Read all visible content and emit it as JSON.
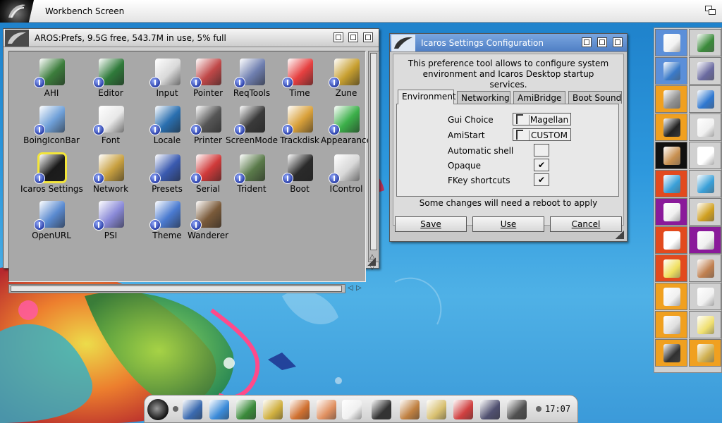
{
  "screen": {
    "title": "Workbench Screen"
  },
  "prefs_window": {
    "title": "AROS:Prefs,  9.5G free, 543.7M in use, 5% full",
    "icons": [
      {
        "label": "AHI",
        "icon": "audio-hardware-icon",
        "color": "#3c7d3c"
      },
      {
        "label": "Editor",
        "icon": "editor-icon",
        "color": "#2f7a3a"
      },
      {
        "label": "Input",
        "icon": "mouse-icon",
        "color": "#d9d9d9"
      },
      {
        "label": "Pointer",
        "icon": "pointer-icon",
        "color": "#c04848"
      },
      {
        "label": "ReqTools",
        "icon": "reqtools-icon",
        "color": "#6f7fb0"
      },
      {
        "label": "Time",
        "icon": "clock-icon",
        "color": "#e64040"
      },
      {
        "label": "Zune",
        "icon": "zune-icon",
        "color": "#c8a030"
      },
      {
        "label": "BoingIconBar",
        "icon": "boing-icon-bar-icon",
        "color": "#6fa0d8"
      },
      {
        "label": "Font",
        "icon": "font-icon",
        "color": "#e8e8e8"
      },
      {
        "label": "Locale",
        "icon": "globe-map-icon",
        "color": "#2a6fb0"
      },
      {
        "label": "Printer",
        "icon": "printer-icon",
        "color": "#555555"
      },
      {
        "label": "ScreenMode",
        "icon": "monitor-icon",
        "color": "#3a3a3a"
      },
      {
        "label": "Trackdisk",
        "icon": "floppy-disk-icon",
        "color": "#d9a13a"
      },
      {
        "label": "Appearance",
        "icon": "appearance-icon",
        "color": "#3cb04a"
      },
      {
        "label": "Icaros Settings",
        "icon": "icaros-logo-icon",
        "color": "#1a1a1a"
      },
      {
        "label": "Network",
        "icon": "network-globe-icon",
        "color": "#c8a040"
      },
      {
        "label": "Presets",
        "icon": "presets-icon",
        "color": "#3a5ab0"
      },
      {
        "label": "Serial",
        "icon": "serial-plug-icon",
        "color": "#d03a3a"
      },
      {
        "label": "Trident",
        "icon": "trident-icon",
        "color": "#5a7a4a"
      },
      {
        "label": "Boot",
        "icon": "boot-terminal-icon",
        "color": "#2a2a2a"
      },
      {
        "label": "IControl",
        "icon": "icontrol-icon",
        "color": "#d8d8d8"
      },
      {
        "label": "OpenURL",
        "icon": "open-url-icon",
        "color": "#5a8ad0"
      },
      {
        "label": "PSI",
        "icon": "psi-screen-icon",
        "color": "#8a8ad8"
      },
      {
        "label": "Theme",
        "icon": "theme-icon",
        "color": "#4a7ad0"
      },
      {
        "label": "Wanderer",
        "icon": "wanderer-icon",
        "color": "#7a5a3a"
      }
    ]
  },
  "icaros_window": {
    "title": "Icaros Settings Configuration",
    "description": "This preference tool allows to configure system environment and Icaros Desktop startup services.",
    "tabs": [
      {
        "label": "Environment",
        "active": true
      },
      {
        "label": "Networking",
        "active": false
      },
      {
        "label": "AmiBridge",
        "active": false
      },
      {
        "label": "Boot Sound",
        "active": false
      }
    ],
    "rows": [
      {
        "label": "Gui Choice",
        "type": "cycle",
        "value": "Magellan"
      },
      {
        "label": "AmiStart",
        "type": "cycle",
        "value": "CUSTOM"
      },
      {
        "label": "Automatic shell",
        "type": "checkbox",
        "value": ""
      },
      {
        "label": "Opaque",
        "type": "checkbox",
        "value": "✔"
      },
      {
        "label": "FKey shortcuts",
        "type": "checkbox",
        "value": "✔"
      }
    ],
    "note": "Some changes will need a reboot to apply",
    "buttons": {
      "save": "Save",
      "use": "Use",
      "cancel": "Cancel"
    }
  },
  "right_dock": {
    "cells": [
      {
        "icon": "document-stack-icon",
        "bg": "#5b8fd9",
        "color": "#f2f2f2"
      },
      {
        "icon": "green-book-icon",
        "bg": "#d0d0d0",
        "color": "#3a8a3a"
      },
      {
        "icon": "blue-box-disk-icon",
        "bg": "#5b8fd9",
        "color": "#3a7ac8"
      },
      {
        "icon": "network-drive-icon",
        "bg": "#d0d0d0",
        "color": "#6a6aa0"
      },
      {
        "icon": "padlock-icon",
        "bg": "#f0a020",
        "color": "#909090"
      },
      {
        "icon": "blue-cube-icon",
        "bg": "#d0d0d0",
        "color": "#2f78d0"
      },
      {
        "icon": "running-man-icon",
        "bg": "#f0a020",
        "color": "#222222"
      },
      {
        "icon": "document-pages-icon",
        "bg": "#d0d0d0",
        "color": "#f0f0f0"
      },
      {
        "icon": "camera-film-icon",
        "bg": "#111111",
        "color": "#c89050"
      },
      {
        "icon": "blank-note-icon",
        "bg": "#d0d0d0",
        "color": "#ffffff"
      },
      {
        "icon": "trash-can-icon",
        "bg": "#e24a1e",
        "color": "#3aa0d8"
      },
      {
        "icon": "trash-can-empty-icon",
        "bg": "#d0d0d0",
        "color": "#3aa0d8"
      },
      {
        "icon": "sparkle-note-icon",
        "bg": "#8a1a9a",
        "color": "#f0f0f0"
      },
      {
        "icon": "star-drive-icon",
        "bg": "#d0d0d0",
        "color": "#d0a020"
      },
      {
        "icon": "terminal-list-icon",
        "bg": "#e24a1e",
        "color": "#ffffff"
      },
      {
        "icon": "blank-page-icon",
        "bg": "#8a1a9a",
        "color": "#f0f0f0"
      },
      {
        "icon": "sticky-note-icon",
        "bg": "#e24a1e",
        "color": "#f0e060"
      },
      {
        "icon": "open-box-icon",
        "bg": "#d0d0d0",
        "color": "#c08050"
      },
      {
        "icon": "half-page-icon",
        "bg": "#f0a020",
        "color": "#f0f0f0"
      },
      {
        "icon": "half-drive-icon",
        "bg": "#d0d0d0",
        "color": "#f0f0f0"
      },
      {
        "icon": "mail-note-icon",
        "bg": "#f0a020",
        "color": "#e0e0e0"
      },
      {
        "icon": "yellow-note-icon",
        "bg": "#d0d0d0",
        "color": "#f0e070"
      },
      {
        "icon": "person-trophy-icon",
        "bg": "#f0a020",
        "color": "#303030"
      },
      {
        "icon": "ftp-folder-icon",
        "bg": "#f0a020",
        "color": "#d0b050"
      }
    ]
  },
  "bottom_dock": {
    "items": [
      {
        "icon": "icaros-start-icon",
        "color": "#222222"
      },
      {
        "icon": "disk-drive-icon",
        "color": "#3a6ab0"
      },
      {
        "icon": "compass-browser-icon",
        "color": "#3a8ad8"
      },
      {
        "icon": "green-book-icon",
        "color": "#3a8a3a"
      },
      {
        "icon": "clapperboard-icon",
        "color": "#d0b040"
      },
      {
        "icon": "paint-program-icon",
        "color": "#d07030"
      },
      {
        "icon": "hand-tool-icon",
        "color": "#e09060"
      },
      {
        "icon": "zune-view-eye-icon",
        "color": "#f0f0f0"
      },
      {
        "icon": "frying-pan-icon",
        "color": "#333333"
      },
      {
        "icon": "brushes-icon",
        "color": "#c08040"
      },
      {
        "icon": "archive-folder-icon",
        "color": "#d8c070"
      },
      {
        "icon": "gauge-icon",
        "color": "#d04040"
      },
      {
        "icon": "butterfly-icon",
        "color": "#505070"
      },
      {
        "icon": "monitor-paint-icon",
        "color": "#505050"
      }
    ],
    "clock": "17:07"
  }
}
